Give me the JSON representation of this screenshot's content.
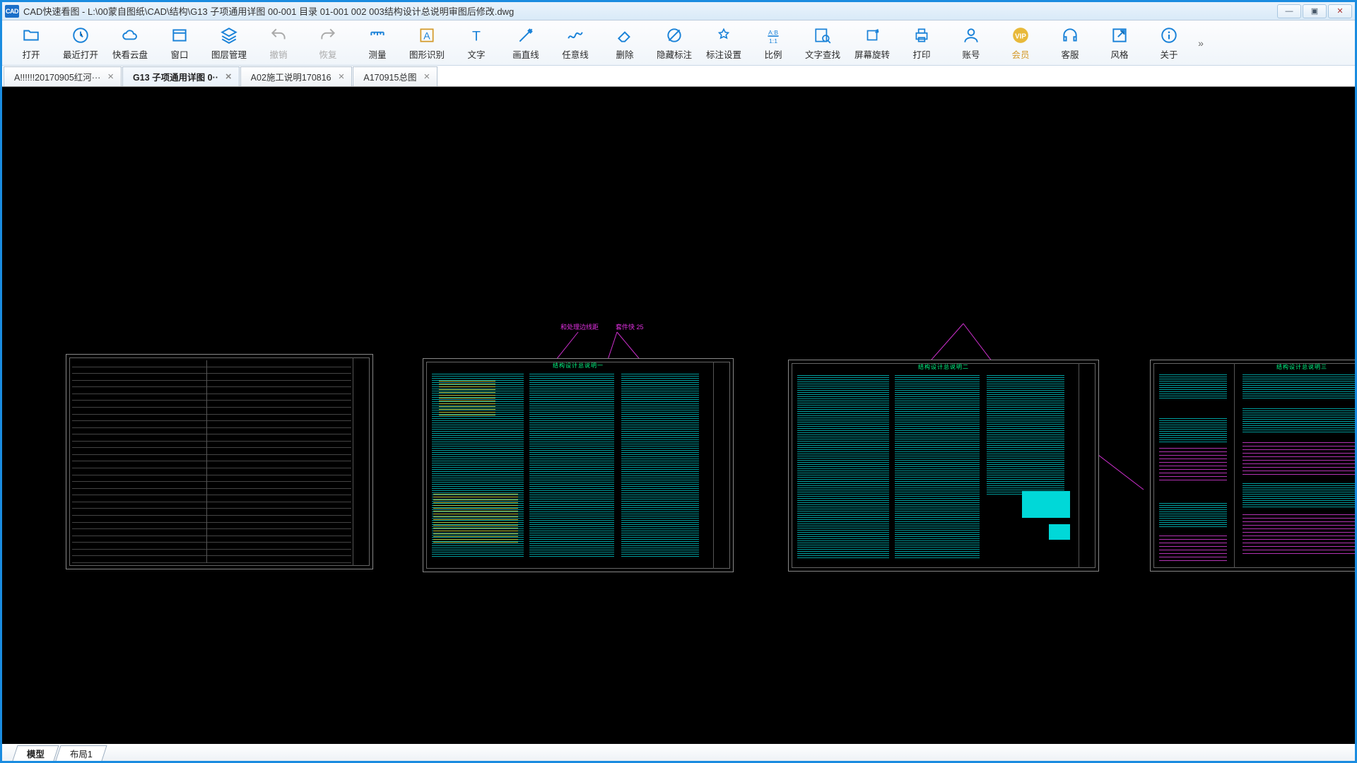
{
  "app": {
    "icon_text": "CAD",
    "title": "CAD快速看图 - L:\\00蒙自图纸\\CAD\\结构\\G13  子项通用详图  00-001 目录 01-001 002 003结构设计总说明审图后修改.dwg"
  },
  "window_buttons": {
    "min": "—",
    "max": "▣",
    "close": "✕"
  },
  "toolbar": [
    {
      "id": "open",
      "label": "打开",
      "icon": "folder",
      "enabled": true
    },
    {
      "id": "recent",
      "label": "最近打开",
      "icon": "history",
      "enabled": true
    },
    {
      "id": "cloud",
      "label": "快看云盘",
      "icon": "cloud",
      "enabled": true
    },
    {
      "id": "window",
      "label": "窗口",
      "icon": "window",
      "enabled": true
    },
    {
      "id": "layers",
      "label": "图层管理",
      "icon": "layers",
      "enabled": true
    },
    {
      "id": "undo",
      "label": "撤销",
      "icon": "undo",
      "enabled": false
    },
    {
      "id": "redo",
      "label": "恢复",
      "icon": "redo",
      "enabled": false
    },
    {
      "id": "measure",
      "label": "测量",
      "icon": "ruler",
      "enabled": true
    },
    {
      "id": "recognize",
      "label": "图形识别",
      "icon": "shapeA",
      "enabled": true
    },
    {
      "id": "text",
      "label": "文字",
      "icon": "textT",
      "enabled": true
    },
    {
      "id": "line",
      "label": "画直线",
      "icon": "lineEdit",
      "enabled": true
    },
    {
      "id": "freeline",
      "label": "任意线",
      "icon": "squiggle",
      "enabled": true
    },
    {
      "id": "delete",
      "label": "删除",
      "icon": "eraser",
      "enabled": true
    },
    {
      "id": "hideanno",
      "label": "隐藏标注",
      "icon": "hide",
      "enabled": true
    },
    {
      "id": "annoset",
      "label": "标注设置",
      "icon": "annoset",
      "enabled": true
    },
    {
      "id": "ratio",
      "label": "比例",
      "icon": "ratio",
      "enabled": true
    },
    {
      "id": "findtext",
      "label": "文字查找",
      "icon": "searchTxt",
      "enabled": true
    },
    {
      "id": "rotate",
      "label": "屏幕旋转",
      "icon": "rotate",
      "enabled": true
    },
    {
      "id": "print",
      "label": "打印",
      "icon": "printer",
      "enabled": true
    },
    {
      "id": "account",
      "label": "账号",
      "icon": "user",
      "enabled": true
    },
    {
      "id": "vip",
      "label": "会员",
      "icon": "vip",
      "enabled": true,
      "vip": true
    },
    {
      "id": "support",
      "label": "客服",
      "icon": "headset",
      "enabled": true
    },
    {
      "id": "style",
      "label": "风格",
      "icon": "export",
      "enabled": true
    },
    {
      "id": "about",
      "label": "关于",
      "icon": "info",
      "enabled": true
    }
  ],
  "overflow_glyph": "»",
  "tabs": [
    {
      "label": "A!!!!!!20170905红河···",
      "active": false
    },
    {
      "label": "G13  子项通用详图   0··",
      "active": true
    },
    {
      "label": "A02施工说明170816",
      "active": false
    },
    {
      "label": "A170915总图",
      "active": false
    }
  ],
  "tab_close_glyph": "×",
  "annotations": {
    "a1": "和处理边线距",
    "a2": "套件快 25"
  },
  "bottom_tabs": [
    {
      "label": "模型",
      "active": true
    },
    {
      "label": "布局1",
      "active": false
    }
  ],
  "sheet_titles": {
    "s2": "结构设计总说明一",
    "s3": "结构设计总说明二",
    "s4": "结构设计总说明三"
  }
}
